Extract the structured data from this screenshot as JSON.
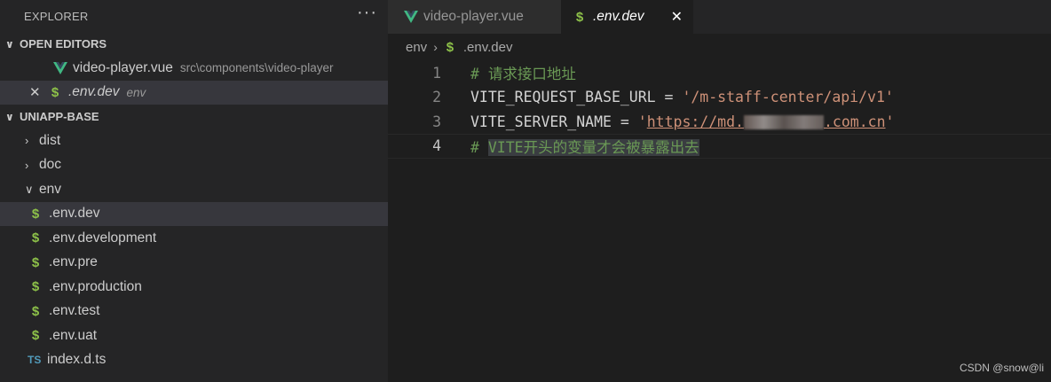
{
  "explorer": {
    "title": "EXPLORER",
    "more": "···",
    "open_editors": {
      "label": "OPEN EDITORS",
      "items": [
        {
          "name": "video-player.vue",
          "desc": "src\\components\\video-player"
        },
        {
          "name": ".env.dev",
          "desc": "env"
        }
      ]
    },
    "project": {
      "label": "UNIAPP-BASE",
      "folders": [
        "dist",
        "doc",
        "env"
      ],
      "env_files": [
        ".env.dev",
        ".env.development",
        ".env.pre",
        ".env.production",
        ".env.test",
        ".env.uat"
      ],
      "ts_file": "index.d.ts",
      "ts_badge": "TS"
    }
  },
  "tabs": [
    {
      "label": "video-player.vue"
    },
    {
      "label": ".env.dev",
      "close": "✕"
    }
  ],
  "breadcrumb": {
    "folder": "env",
    "file": ".env.dev"
  },
  "editor": {
    "line_numbers": [
      "1",
      "2",
      "3",
      "4"
    ],
    "line1": "# 请求接口地址",
    "line2_key": "VITE_REQUEST_BASE_URL",
    "line2_op": " = ",
    "line2_val": "'/m-staff-center/api/v1'",
    "line3_key": "VITE_SERVER_NAME",
    "line3_op": " = ",
    "line3_q1": "'",
    "line3_url_a": "https://md.",
    "line3_url_b": ".com.cn",
    "line3_q2": "'",
    "line4_hash": "# ",
    "line4": "VITE开头的变量才会被暴露出去"
  },
  "watermark": "CSDN @snow@li",
  "colors": {
    "vue": "#41b883",
    "env": "#8dc149",
    "ts": "#519aba",
    "comment": "#6a9955",
    "string": "#ce9178"
  }
}
